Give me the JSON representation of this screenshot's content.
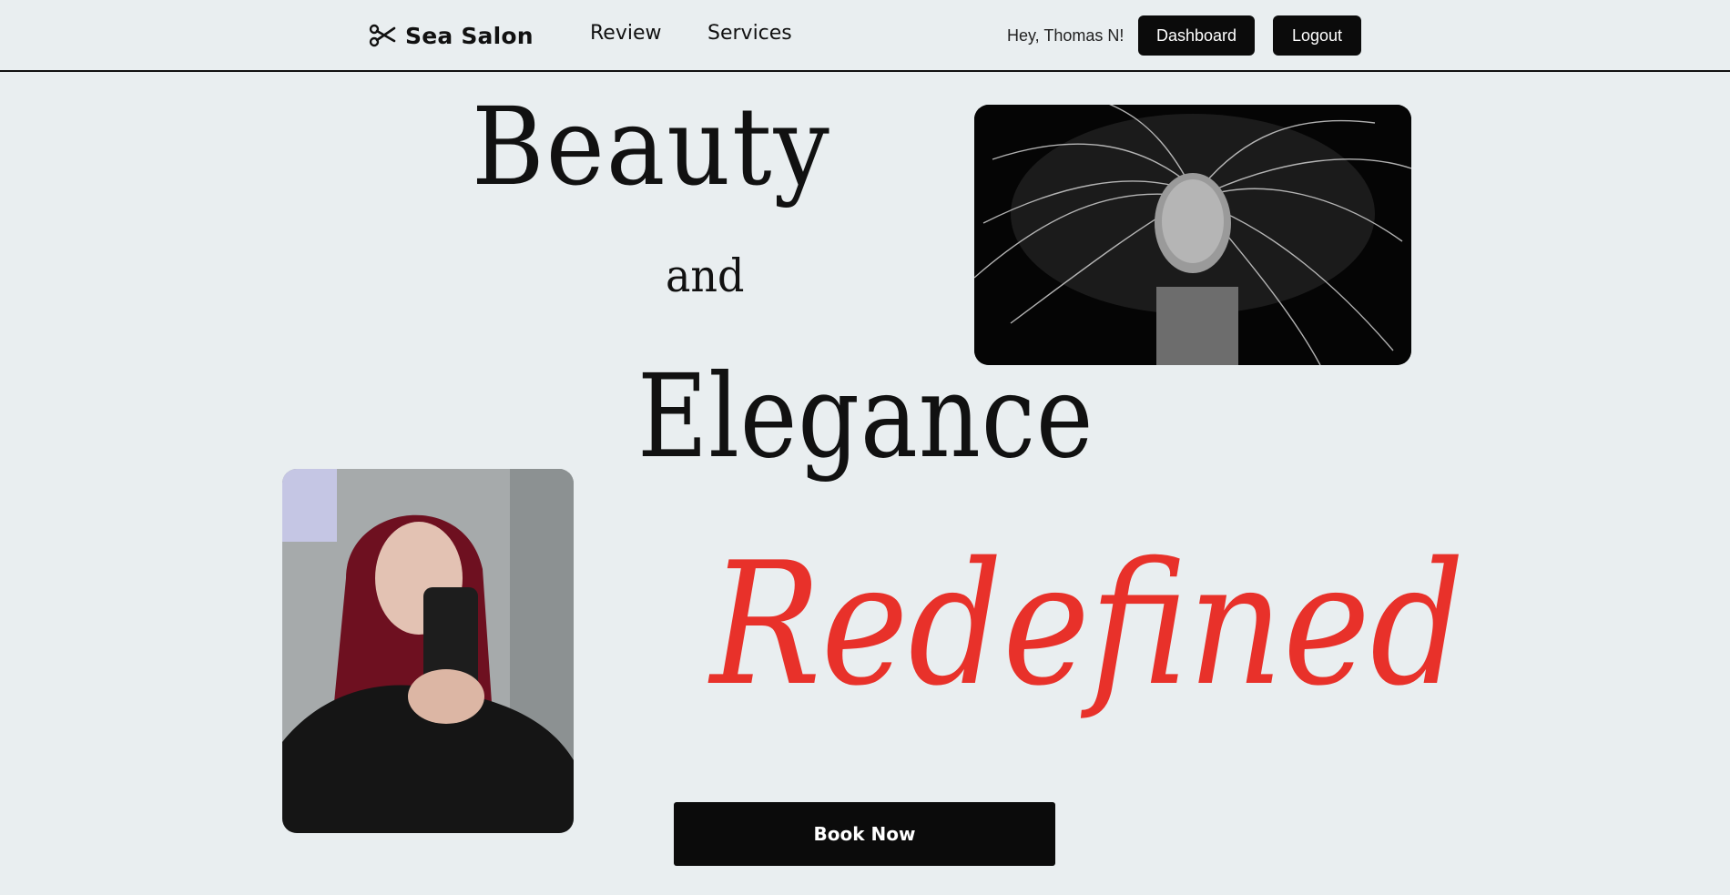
{
  "brand": {
    "name": "Sea Salon",
    "icon": "scissors-icon"
  },
  "nav": {
    "review": "Review",
    "services": "Services"
  },
  "user": {
    "greeting": "Hey, Thomas N!"
  },
  "actions": {
    "dashboard": "Dashboard",
    "logout": "Logout",
    "book_now": "Book Now"
  },
  "hero": {
    "line1": "Beauty",
    "line2": "and",
    "line3": "Elegance",
    "line4": "Redefined",
    "accent_color": "#e8312a"
  },
  "colors": {
    "background": "#e9eef0",
    "primary_button": "#0b0b0b"
  }
}
